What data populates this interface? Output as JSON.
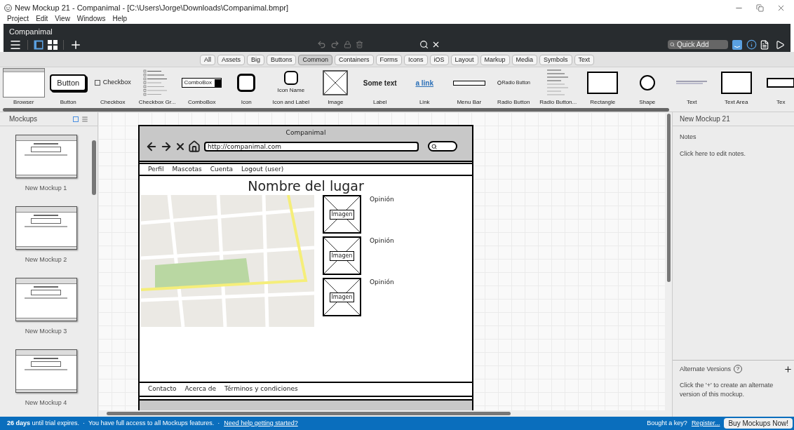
{
  "window": {
    "title": "New Mockup 21 - Companimal - [C:\\Users\\Jorge\\Downloads\\Companimal.bmpr]"
  },
  "menu": [
    "Project",
    "Edit",
    "View",
    "Windows",
    "Help"
  ],
  "project_title": "Companimal",
  "quick_add": {
    "placeholder": "Quick Add"
  },
  "filters": [
    {
      "label": "All",
      "selected": false
    },
    {
      "label": "Assets",
      "selected": false
    },
    {
      "label": "Big",
      "selected": false
    },
    {
      "label": "Buttons",
      "selected": false
    },
    {
      "label": "Common",
      "selected": true
    },
    {
      "label": "Containers",
      "selected": false
    },
    {
      "label": "Forms",
      "selected": false
    },
    {
      "label": "Icons",
      "selected": false
    },
    {
      "label": "iOS",
      "selected": false
    },
    {
      "label": "Layout",
      "selected": false
    },
    {
      "label": "Markup",
      "selected": false
    },
    {
      "label": "Media",
      "selected": false
    },
    {
      "label": "Symbols",
      "selected": false
    },
    {
      "label": "Text",
      "selected": false
    }
  ],
  "library": [
    {
      "kind": "browser",
      "label": "Browser"
    },
    {
      "kind": "button",
      "label": "Button",
      "preview": "Button"
    },
    {
      "kind": "checkbox",
      "label": "Checkbox",
      "preview": "Checkbox"
    },
    {
      "kind": "checkbox_group",
      "label": "Checkbox Gr..."
    },
    {
      "kind": "combobox",
      "label": "ComboBox",
      "preview": "ComboBox"
    },
    {
      "kind": "icon",
      "label": "Icon"
    },
    {
      "kind": "icon_label",
      "label": "Icon and Label",
      "preview": "Icon Name"
    },
    {
      "kind": "image",
      "label": "Image"
    },
    {
      "kind": "label",
      "label": "Label",
      "preview": "Some text"
    },
    {
      "kind": "link",
      "label": "Link",
      "preview": "a link"
    },
    {
      "kind": "menubar",
      "label": "Menu Bar"
    },
    {
      "kind": "radio",
      "label": "Radio Button",
      "preview": "Radio Button"
    },
    {
      "kind": "radio_group",
      "label": "Radio Button..."
    },
    {
      "kind": "rectangle",
      "label": "Rectangle"
    },
    {
      "kind": "shape",
      "label": "Shape"
    },
    {
      "kind": "text",
      "label": "Text"
    },
    {
      "kind": "textarea",
      "label": "Text Area"
    },
    {
      "kind": "textinput",
      "label": "Tex"
    }
  ],
  "mockups": {
    "title": "Mockups",
    "items": [
      {
        "label": "New Mockup 1"
      },
      {
        "label": "New Mockup 2"
      },
      {
        "label": "New Mockup 3"
      },
      {
        "label": "New Mockup 4"
      }
    ]
  },
  "canvas": {
    "title": "Companimal",
    "url": "http://companimal.com",
    "nav": [
      "Perfil",
      "Mascotas",
      "Cuenta",
      "Logout (user)"
    ],
    "heading": "Nombre del lugar",
    "reviews": [
      {
        "image": "Imagen",
        "text": "Opinión"
      },
      {
        "image": "Imagen",
        "text": "Opinión"
      },
      {
        "image": "Imagen",
        "text": "Opinión"
      }
    ],
    "footer": [
      "Contacto",
      "Acerca de",
      "Términos y condiciones"
    ]
  },
  "inspector": {
    "title": "New Mockup 21",
    "notes_label": "Notes",
    "notes_hint": "Click here to edit notes.",
    "alternates_title": "Alternate Versions",
    "help": "?",
    "alternates_hint": "Click the '+' to create an alternate version of this mockup."
  },
  "status": {
    "message": "**26 days** until trial expires.  ·  You have full access to all Mockups features.  ·",
    "help_link": "Need help getting started?",
    "key_text": "Bought a key?",
    "register": "Register...",
    "buy": "Buy Mockups Now!"
  }
}
